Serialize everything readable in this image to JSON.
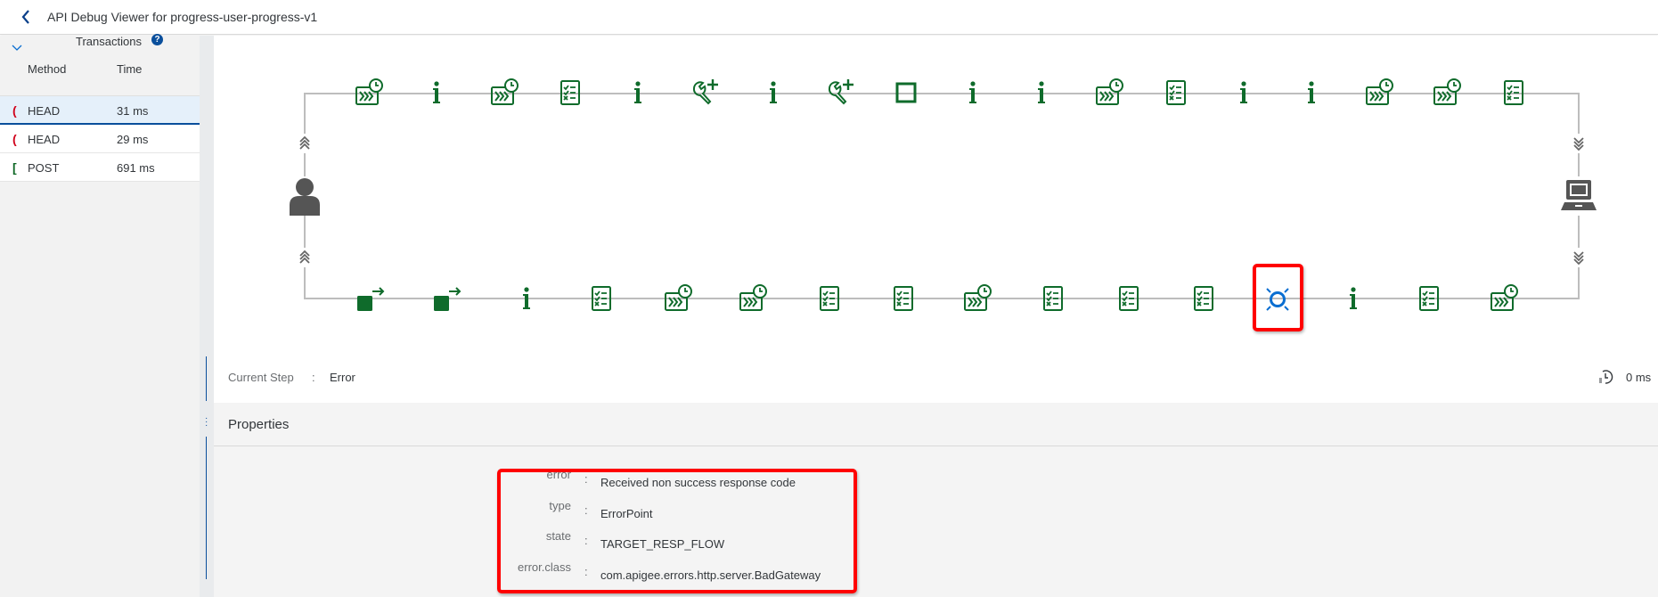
{
  "header": {
    "title": "API Debug Viewer for progress-user-progress-v1",
    "back_icon": "chevron-left-icon"
  },
  "sidebar": {
    "section_title": "Transactions",
    "help_icon": "question-circle-icon",
    "columns": {
      "method": "Method",
      "time": "Time"
    },
    "transactions": [
      {
        "method": "HEAD",
        "time": "31 ms",
        "status_icon": "error-bracket-icon",
        "status_color": "#d0021b",
        "selected": true
      },
      {
        "method": "HEAD",
        "time": "29 ms",
        "status_icon": "error-bracket-icon",
        "status_color": "#d0021b",
        "selected": false
      },
      {
        "method": "POST",
        "time": "691 ms",
        "status_icon": "success-bracket-icon",
        "status_color": "#0b6623",
        "selected": false
      }
    ]
  },
  "flow": {
    "colors": {
      "policy": "#0f6b2b",
      "error": "#0a6ed1",
      "endpoint": "#555555",
      "highlight": "#ff0000"
    },
    "request_steps": [
      "flow-timer",
      "info",
      "flow-timer",
      "checklist",
      "info",
      "wrench-plus",
      "info",
      "wrench-plus",
      "square",
      "info",
      "info",
      "flow-timer",
      "checklist",
      "info",
      "info",
      "flow-timer",
      "flow-timer",
      "checklist"
    ],
    "response_steps": [
      "square-arrow",
      "square-arrow",
      "info",
      "checklist",
      "flow-timer",
      "flow-timer",
      "checklist",
      "checklist",
      "flow-timer",
      "checklist",
      "checklist",
      "checklist",
      "error-point",
      "info",
      "checklist",
      "flow-timer"
    ],
    "selected_response_index": 12,
    "client_icon": "user-icon",
    "target_icon": "laptop-icon"
  },
  "current_step": {
    "label": "Current Step",
    "separator": ":",
    "value": "Error",
    "elapsed": "0 ms",
    "elapsed_icon": "history-icon"
  },
  "properties": {
    "title": "Properties",
    "items": [
      {
        "key": "error",
        "value": "Received non success response code"
      },
      {
        "key": "type",
        "value": "ErrorPoint"
      },
      {
        "key": "state",
        "value": "TARGET_RESP_FLOW"
      },
      {
        "key": "error.class",
        "value": "com.apigee.errors.http.server.BadGateway"
      }
    ]
  }
}
